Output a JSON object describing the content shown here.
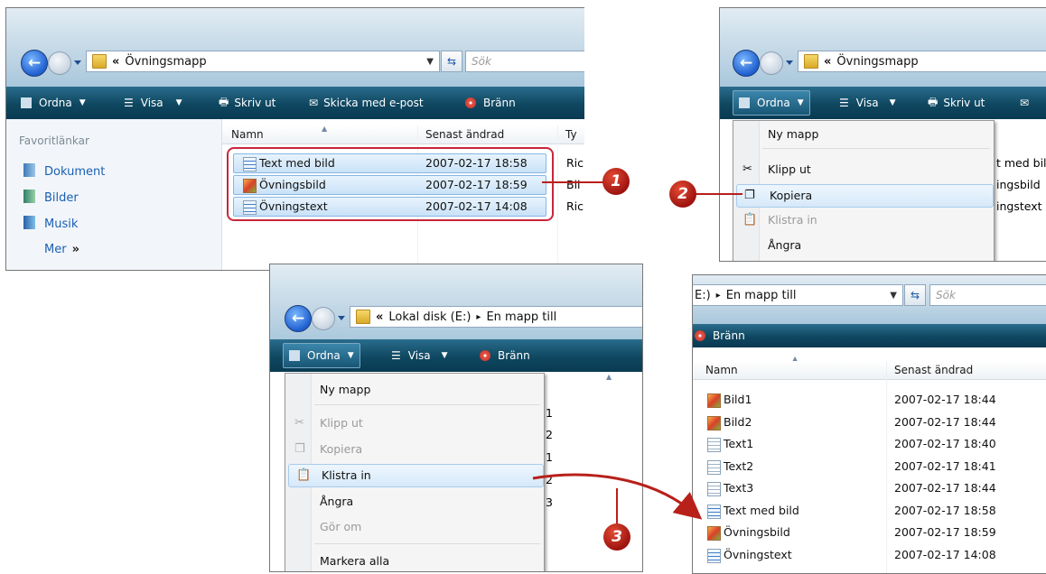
{
  "colors": {
    "badge": "#b41c14",
    "toolbar": "#0f4760",
    "link": "#1a5fb4",
    "arrow": "#b8201a"
  },
  "panel1": {
    "address": {
      "chevron": "«",
      "path": "Övningsmapp"
    },
    "search_placeholder": "Sök",
    "toolbar": {
      "organize": "Ordna",
      "view": "Visa",
      "print": "Skriv ut",
      "email": "Skicka med e-post",
      "burn": "Bränn"
    },
    "sidebar": {
      "heading": "Favoritlänkar",
      "links": [
        "Dokument",
        "Bilder",
        "Musik"
      ],
      "more": "Mer"
    },
    "columns": {
      "name": "Namn",
      "modified": "Senast ändrad",
      "type": "Ty"
    },
    "files": [
      {
        "name": "Text med bild",
        "date": "2007-02-17 18:58",
        "type": "Ric",
        "icon": "rtf-icon"
      },
      {
        "name": "Övningsbild",
        "date": "2007-02-17 18:59",
        "type": "Bil",
        "icon": "image-icon"
      },
      {
        "name": "Övningstext",
        "date": "2007-02-17 14:08",
        "type": "Ric",
        "icon": "rtf-icon"
      }
    ]
  },
  "panel2": {
    "address": {
      "chevron": "«",
      "path": "Övningsmapp"
    },
    "toolbar": {
      "organize": "Ordna",
      "view": "Visa",
      "print": "Skriv ut"
    },
    "menu": [
      "Ny mapp",
      "Klipp ut",
      "Kopiera",
      "Klistra in",
      "Ångra"
    ],
    "behind": [
      "t med bil",
      "ingsbild",
      "ingstext"
    ]
  },
  "panel3": {
    "address": {
      "chevron": "«",
      "drive": "Lokal disk (E:)",
      "sep": "▸",
      "folder": "En mapp till"
    },
    "toolbar": {
      "organize": "Ordna",
      "view": "Visa",
      "burn": "Bränn"
    },
    "menu": [
      "Ny mapp",
      "Klipp ut",
      "Kopiera",
      "Klistra in",
      "Ångra",
      "Gör om",
      "Markera alla"
    ],
    "behind": [
      "1",
      "2",
      "1",
      "2",
      "3"
    ]
  },
  "panel4": {
    "address": {
      "prefix": "E:)",
      "sep": "▸",
      "folder": "En mapp till"
    },
    "search_placeholder": "Sök",
    "toolbar": {
      "burn": "Bränn"
    },
    "columns": {
      "name": "Namn",
      "modified": "Senast ändrad"
    },
    "files": [
      {
        "name": "Bild1",
        "date": "2007-02-17 18:44",
        "icon": "image-icon"
      },
      {
        "name": "Bild2",
        "date": "2007-02-17 18:44",
        "icon": "image-icon"
      },
      {
        "name": "Text1",
        "date": "2007-02-17 18:40",
        "icon": "text-icon"
      },
      {
        "name": "Text2",
        "date": "2007-02-17 18:41",
        "icon": "text-icon"
      },
      {
        "name": "Text3",
        "date": "2007-02-17 18:44",
        "icon": "text-icon"
      },
      {
        "name": "Text med bild",
        "date": "2007-02-17 18:58",
        "icon": "rtf-icon"
      },
      {
        "name": "Övningsbild",
        "date": "2007-02-17 18:59",
        "icon": "image-icon"
      },
      {
        "name": "Övningstext",
        "date": "2007-02-17 14:08",
        "icon": "rtf-icon"
      }
    ]
  },
  "badges": [
    "1",
    "2",
    "3"
  ]
}
